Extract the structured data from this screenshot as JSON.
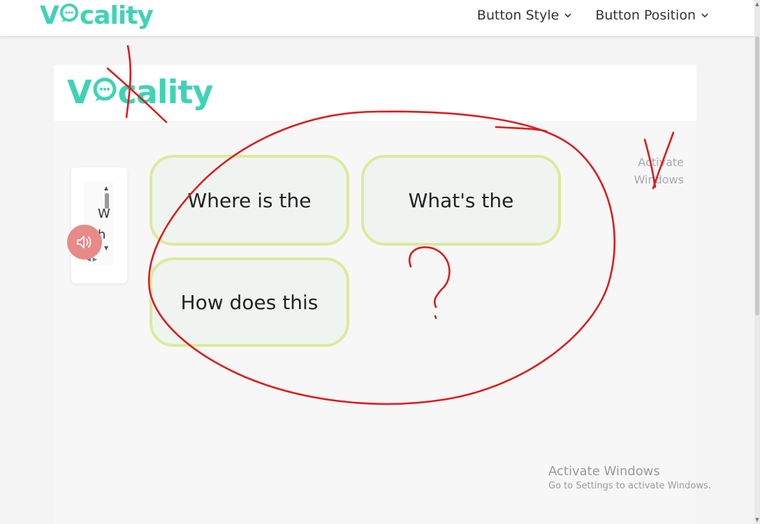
{
  "brand": {
    "logo_text": "Vocality",
    "logo_before": "V",
    "logo_after": "cality",
    "color": "#3fd3b5"
  },
  "nav": {
    "items": [
      {
        "label": "Button Style"
      },
      {
        "label": "Button Position"
      }
    ]
  },
  "widget": {
    "lines": [
      "W",
      "h"
    ],
    "speaker_icon": "speaker-icon",
    "speaker_color": "#e88a88"
  },
  "questions": [
    {
      "label": "Where is the"
    },
    {
      "label": "What's the"
    },
    {
      "label": "How does this"
    }
  ],
  "preview_overlay": {
    "line1": "Activate",
    "line2": "Windows"
  },
  "watermark": {
    "title": "Activate Windows",
    "subtitle": "Go to Settings to activate Windows."
  },
  "colors": {
    "button_border": "#dde99a",
    "button_bg": "#eff4f1",
    "annotation": "#dd1c1c"
  }
}
